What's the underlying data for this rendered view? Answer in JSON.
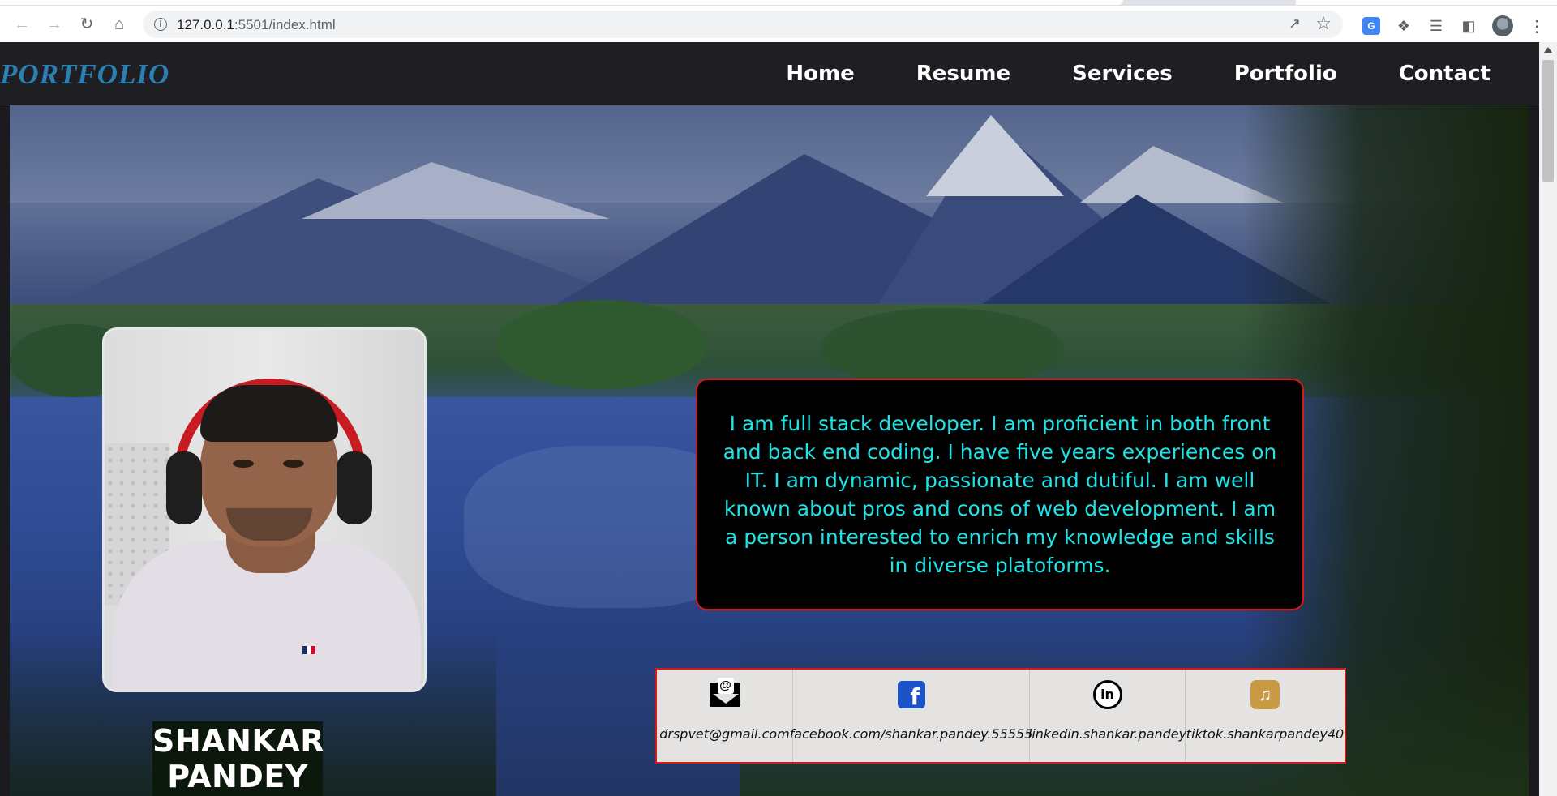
{
  "browser": {
    "url_host": "127.0.0.1",
    "url_rest": ":5501/index.html"
  },
  "site": {
    "logo": "PORTFOLIO",
    "nav": [
      "Home",
      "Resume",
      "Services",
      "Portfolio",
      "Contact"
    ]
  },
  "hero": {
    "name": "SHANKAR PANDEY",
    "about": "I am full stack developer. I am proficient in both front and back end coding. I have five years experiences on IT. I am dynamic, passionate and dutiful. I am well known about pros and cons of web development. I am a person interested to enrich my knowledge and skills in diverse platoforms.",
    "contacts": [
      {
        "icon": "email-icon",
        "text": "drspvet@gmail.com"
      },
      {
        "icon": "facebook-icon",
        "text": "facebook.com/shankar.pandey.55555"
      },
      {
        "icon": "linkedin-icon",
        "text": "linkedin.shankar.pandey"
      },
      {
        "icon": "tiktok-icon",
        "text": "tiktok.shankarpandey40"
      }
    ]
  },
  "colors": {
    "logo": "#2b7fb3",
    "about_text": "#1ee4e8",
    "border_accent": "#d31919",
    "nav_bg": "#1f1e22"
  }
}
